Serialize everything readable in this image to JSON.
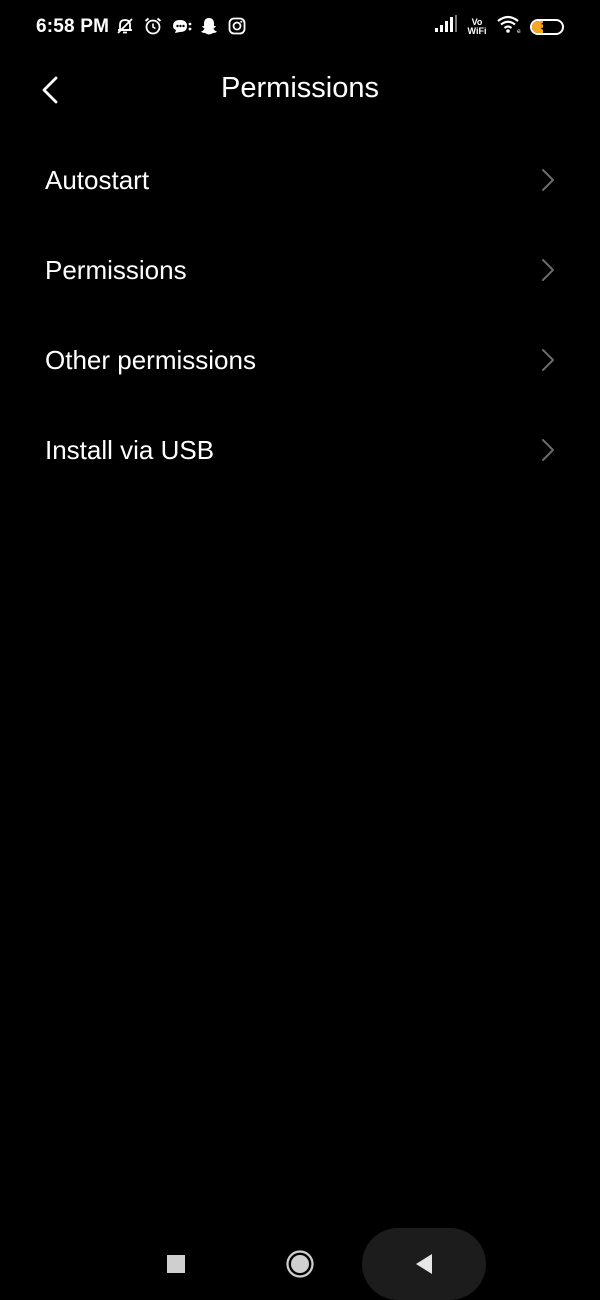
{
  "status_bar": {
    "time": "6:58 PM",
    "left_icons": [
      "bell-off-icon",
      "alarm-icon",
      "chat-bubble-icon",
      "snapchat-icon",
      "instagram-icon"
    ],
    "right_icons": [
      "signal-icon",
      "vowifi-icon",
      "wifi-icon",
      "battery-icon"
    ],
    "vowifi_top": "Vo",
    "vowifi_bottom": "WiFi",
    "battery_level": "37",
    "battery_fraction": 0.37,
    "battery_color": "#f5a623"
  },
  "header": {
    "title": "Permissions",
    "back_icon": "chevron-left-icon"
  },
  "list": {
    "items": [
      {
        "label": "Autostart"
      },
      {
        "label": "Permissions"
      },
      {
        "label": "Other permissions"
      },
      {
        "label": "Install via USB"
      }
    ],
    "item_icon": "chevron-right-icon"
  },
  "nav_bar": {
    "buttons": [
      "recents-square-icon",
      "home-circle-icon",
      "back-triangle-icon"
    ]
  },
  "colors": {
    "background": "#000000",
    "text": "#ffffff",
    "chevron": "#6b6b6b",
    "nav_pill": "#1c1c1c"
  }
}
